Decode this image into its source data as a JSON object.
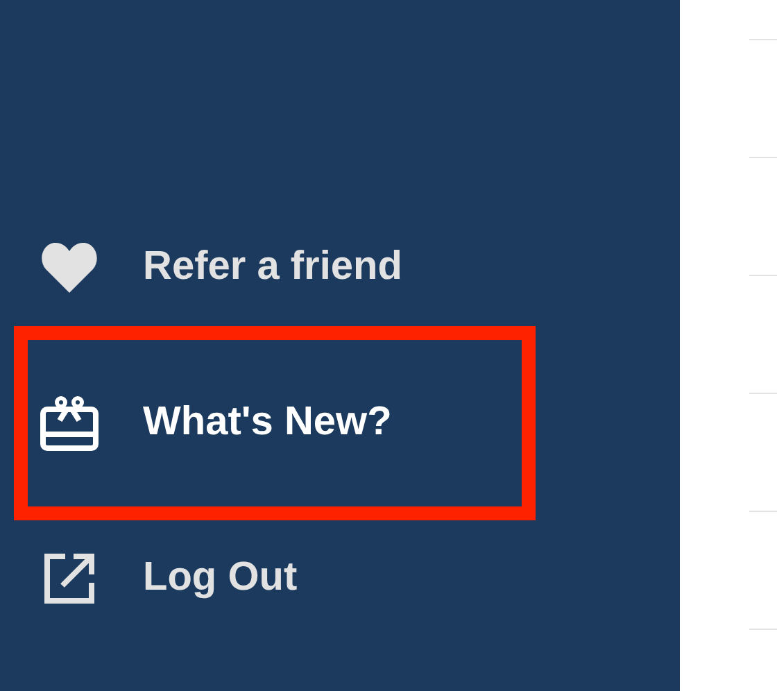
{
  "sidebar": {
    "items": [
      {
        "label": "Refer a friend",
        "kind": "heart",
        "highlighted": false
      },
      {
        "label": "What's New?",
        "kind": "gift",
        "highlighted": true
      },
      {
        "label": "Log Out",
        "kind": "external",
        "highlighted": false
      }
    ]
  }
}
